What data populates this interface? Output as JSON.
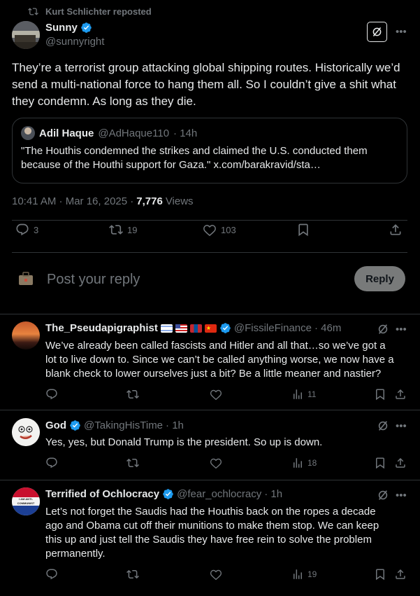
{
  "repost": {
    "text": "Kurt Schlichter reposted"
  },
  "tweet": {
    "name": "Sunny",
    "handle": "@sunnyright",
    "text": "They’re a terrorist group attacking global shipping routes. Historically we’d send a multi-national force to hang them all. So I couldn’t give a shit what they condemn. As long as they die.",
    "quote": {
      "name": "Adil Haque",
      "handle": "@AdHaque110",
      "time": "· 14h",
      "text": "\"The Houthis condemned the strikes and claimed the U.S. conducted them because of the Houthi support for Gaza.\" x.com/barakravid/sta…"
    },
    "timestamp": "10:41 AM · Mar 16, 2025 ·",
    "views": "7,776",
    "views_label": "Views",
    "replies": "3",
    "reposts": "19",
    "likes": "103"
  },
  "composer": {
    "placeholder": "Post your reply",
    "button": "Reply"
  },
  "replies": [
    {
      "name": "The_Pseudapigraphist",
      "handle": "@FissileFinance",
      "time": "· 46m",
      "text": "We’ve already been called fascists and Hitler and all that…so we’ve got a lot to live down to. Since we can’t be called anything worse, we now have a blank check to lower ourselves just a bit? Be a little meaner and nastier?",
      "views": "11"
    },
    {
      "name": "God",
      "handle": "@TakingHisTime",
      "time": "· 1h",
      "text": "Yes, yes, but Donald Trump is the president. So up is down.",
      "views": "18"
    },
    {
      "name": "Terrified of Ochlocracy",
      "handle": "@fear_ochlocracy",
      "time": "· 1h",
      "text": "Let’s not forget the Saudis had the Houthis back on the ropes a decade ago and Obama cut off their munitions to make them stop. We can keep this up and just tell the Saudis they have free rein to solve the problem permanently.",
      "views": "19",
      "avatar_text": "I AM ANTI-COMMUNIST"
    }
  ],
  "colors": {
    "accent": "#1d9bf0",
    "muted": "#71767b",
    "border": "#2f3336",
    "text": "#e7e9ea"
  }
}
